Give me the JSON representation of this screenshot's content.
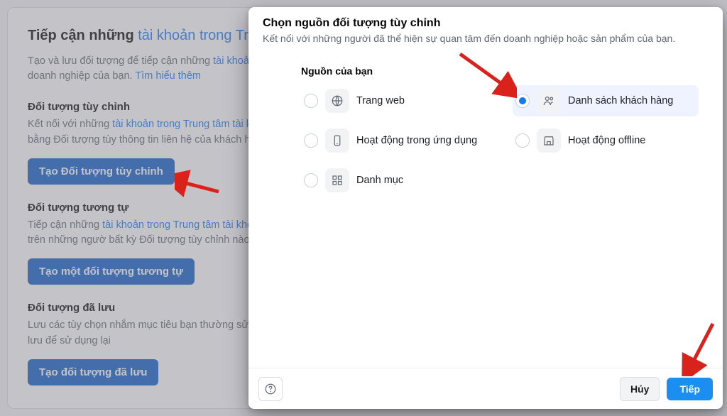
{
  "bg": {
    "title_prefix": "Tiếp cận những ",
    "title_link": "tài khoản trong Trung tâm tà",
    "lead_before_link": "Tạo và lưu đối tượng để tiếp cận những ",
    "lead_link": "tài khoản t",
    "lead_line2_before_link": "doanh nghiệp của bạn. ",
    "lead_learn_more": "Tìm hiểu thêm",
    "sections": [
      {
        "heading": "Đối tượng tùy chỉnh",
        "body_before": "Kết nối với những ",
        "body_link": "tài khoản trong Trung tâm tài kho",
        "body_after": " nghiệp hoặc sản phẩm của bạn bằng Đối tượng tùy thông tin liên hệ của khách hàng, lưu lượng truy cập",
        "button": "Tạo Đối tượng tùy chỉnh"
      },
      {
        "heading": "Đối tượng tương tự",
        "body_before": "Tiếp cận những ",
        "body_link": "tài khoản trong Trung tâm tài khoả",
        "body_after": " có thể tạo đối tượng tương tự dựa trên những ngườ bất kỳ Đối tượng tùy chỉnh nào mà bạn hiện có.",
        "button": "Tạo một đối tượng tương tự"
      },
      {
        "heading": "Đối tượng đã lưu",
        "body_before": "",
        "body_link": "",
        "body_after": "Lưu các tùy chọn nhắm mục tiêu bạn thường sử dụ khẩu học, sở thích và hành vi rồi lưu để sử dụng lại",
        "button": "Tạo đối tượng đã lưu"
      }
    ]
  },
  "modal": {
    "title": "Chọn nguồn đối tượng tùy chỉnh",
    "subtitle": "Kết nối với những người đã thể hiện sự quan tâm đến doanh nghiệp hoặc sản phẩm của bạn.",
    "group_label": "Nguồn của bạn",
    "sources": [
      {
        "label": "Trang web",
        "icon": "globe-icon",
        "selected": false
      },
      {
        "label": "Danh sách khách hàng",
        "icon": "users-icon",
        "selected": true
      },
      {
        "label": "Hoạt động trong ứng dụng",
        "icon": "phone-icon",
        "selected": false
      },
      {
        "label": "Hoạt động offline",
        "icon": "store-icon",
        "selected": false
      },
      {
        "label": "Danh mục",
        "icon": "grid-icon",
        "selected": false
      }
    ],
    "footer": {
      "help_title": "Help",
      "cancel": "Hủy",
      "next": "Tiếp"
    }
  },
  "colors": {
    "primary_blue": "#1877f2",
    "button_dark_blue": "#0a5cc7",
    "icon_gray": "#606770",
    "arrow_red": "#d9221c"
  }
}
